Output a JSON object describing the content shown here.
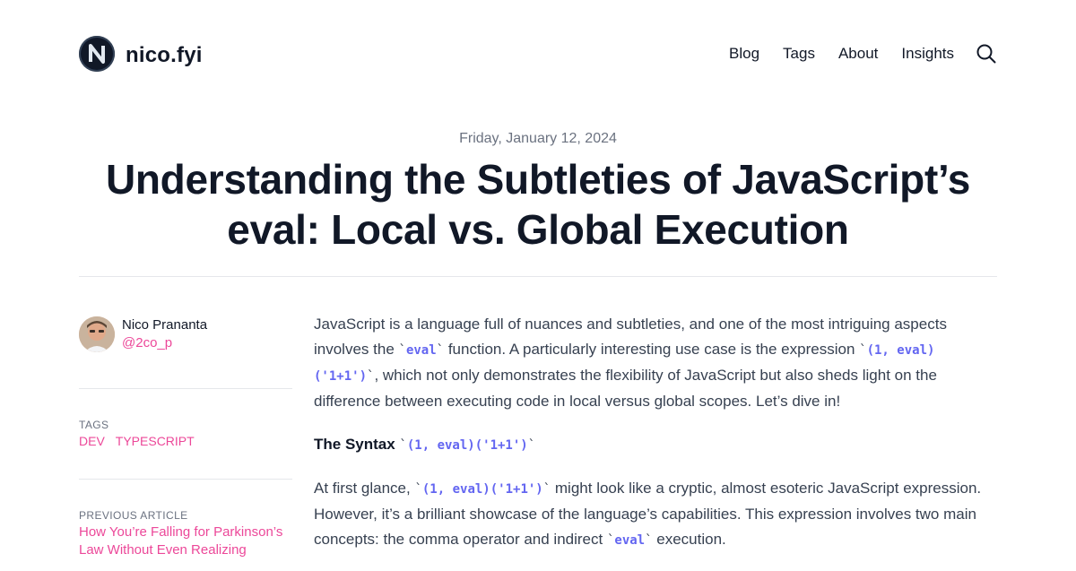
{
  "site": {
    "title": "nico.fyi"
  },
  "nav": {
    "items": [
      {
        "label": "Blog"
      },
      {
        "label": "Tags"
      },
      {
        "label": "About"
      },
      {
        "label": "Insights"
      }
    ]
  },
  "post": {
    "date": "Friday, January 12, 2024",
    "title": "Understanding the Subtleties of JavaScript’s eval: Local vs. Global Execution"
  },
  "author": {
    "name": "Nico Prananta",
    "handle": "@2co_p"
  },
  "sidebar": {
    "tags_label": "Tags",
    "tags": [
      "dev",
      "typescript"
    ],
    "previous_label": "Previous Article",
    "previous_title": "How You’re Falling for Parkinson’s Law Without Even Realizing"
  },
  "article": {
    "p1_a": "JavaScript is a language full of nuances and subtleties, and one of the most intriguing aspects involves the ",
    "p1_code1": "eval",
    "p1_b": " function. A particularly interesting use case is the expression ",
    "p1_code2": "(1, eval)('1+1')",
    "p1_c": ", which not only demonstrates the flexibility of JavaScript but also sheds light on the difference between executing code in local versus global scopes. Let’s dive in!",
    "h2_text": "The Syntax ",
    "h2_code": "(1, eval)('1+1')",
    "p2_a": "At first glance, ",
    "p2_code1": "(1, eval)('1+1')",
    "p2_b": " might look like a cryptic, almost esoteric JavaScript expression. However, it’s a brilliant showcase of the language’s capabilities. This expression involves two main concepts: the comma operator and indirect ",
    "p2_code2": "eval",
    "p2_c": " execution."
  },
  "colors": {
    "accent": "#ec4899",
    "code": "#6366f1",
    "text": "#111827",
    "muted": "#6b7280"
  },
  "icons": {
    "logo": "n-logo-icon",
    "search": "search-icon"
  }
}
